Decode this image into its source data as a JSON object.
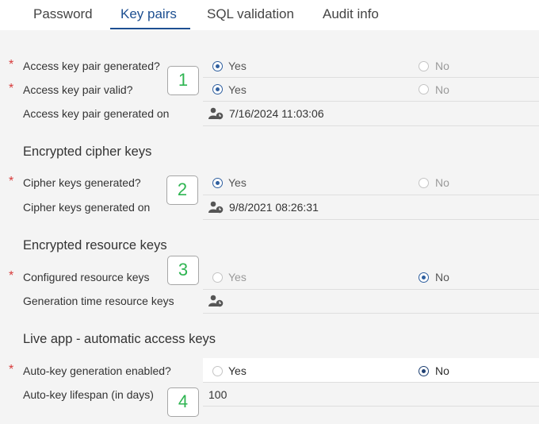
{
  "tabs": [
    {
      "label": "Password",
      "active": false
    },
    {
      "label": "Key pairs",
      "active": true
    },
    {
      "label": "SQL validation",
      "active": false
    },
    {
      "label": "Audit info",
      "active": false
    }
  ],
  "required_marker": "*",
  "options": {
    "yes": "Yes",
    "no": "No"
  },
  "access_keys": {
    "generated_label": "Access key pair generated?",
    "generated_value": "Yes",
    "valid_label": "Access key pair valid?",
    "valid_value": "Yes",
    "generated_on_label": "Access key pair generated on",
    "generated_on_value": "7/16/2024 11:03:06"
  },
  "cipher_keys": {
    "title": "Encrypted cipher keys",
    "generated_label": "Cipher keys generated?",
    "generated_value": "Yes",
    "generated_on_label": "Cipher keys generated on",
    "generated_on_value": "9/8/2021 08:26:31"
  },
  "resource_keys": {
    "title": "Encrypted resource keys",
    "configured_label": "Configured resource keys",
    "configured_value": "No",
    "generation_time_label": "Generation time resource keys",
    "generation_time_value": ""
  },
  "live_app": {
    "title": "Live app - automatic access keys",
    "auto_key_label": "Auto-key generation enabled?",
    "auto_key_value": "No",
    "lifespan_label": "Auto-key lifespan (in days)",
    "lifespan_value": "100"
  },
  "callouts": [
    "1",
    "2",
    "3",
    "4"
  ],
  "icons": {
    "user_clock": "user-clock-icon"
  },
  "colors": {
    "accent": "#1d4f91",
    "required": "#d83b3b",
    "callout_number": "#2fb552",
    "background": "#f4f4f4"
  }
}
